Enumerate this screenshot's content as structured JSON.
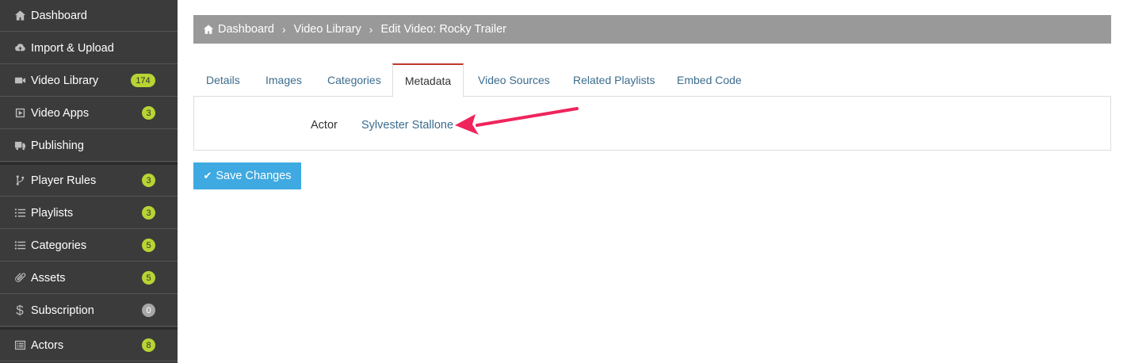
{
  "sidebar": {
    "items": [
      {
        "label": "Dashboard",
        "icon": "home-icon",
        "badge": ""
      },
      {
        "label": "Import & Upload",
        "icon": "cloud-upload-icon",
        "badge": ""
      },
      {
        "label": "Video Library",
        "icon": "video-camera-icon",
        "badge": "174"
      },
      {
        "label": "Video Apps",
        "icon": "play-square-icon",
        "badge": "3"
      },
      {
        "label": "Publishing",
        "icon": "truck-icon",
        "badge": ""
      },
      {
        "label": "Player Rules",
        "icon": "branch-icon",
        "badge": "3"
      },
      {
        "label": "Playlists",
        "icon": "list-ordered-icon",
        "badge": "3"
      },
      {
        "label": "Categories",
        "icon": "list-icon",
        "badge": "5"
      },
      {
        "label": "Assets",
        "icon": "paperclip-icon",
        "badge": "5"
      },
      {
        "label": "Subscription",
        "icon": "dollar-icon",
        "badge": "0"
      },
      {
        "label": "Actors",
        "icon": "list-alt-icon",
        "badge": "8"
      }
    ],
    "badge_color": "#b7d433",
    "badge_zero_color": "#a7a7a7"
  },
  "breadcrumb": {
    "items": [
      "Dashboard",
      "Video Library",
      "Edit Video: Rocky Trailer"
    ],
    "separator": "›"
  },
  "tabs": [
    {
      "label": "Details",
      "active": false
    },
    {
      "label": "Images",
      "active": false
    },
    {
      "label": "Categories",
      "active": false
    },
    {
      "label": "Metadata",
      "active": true
    },
    {
      "label": "Video Sources",
      "active": false
    },
    {
      "label": "Related Playlists",
      "active": false
    },
    {
      "label": "Embed Code",
      "active": false
    }
  ],
  "metadata": {
    "field_label": "Actor",
    "field_value": "Sylvester Stallone"
  },
  "actions": {
    "save_label": "Save Changes"
  },
  "colors": {
    "accent": "#3fa9e1",
    "link": "#3c6c8e",
    "active_tab_border": "#c0392b",
    "annotation_arrow": "#f0245c"
  }
}
